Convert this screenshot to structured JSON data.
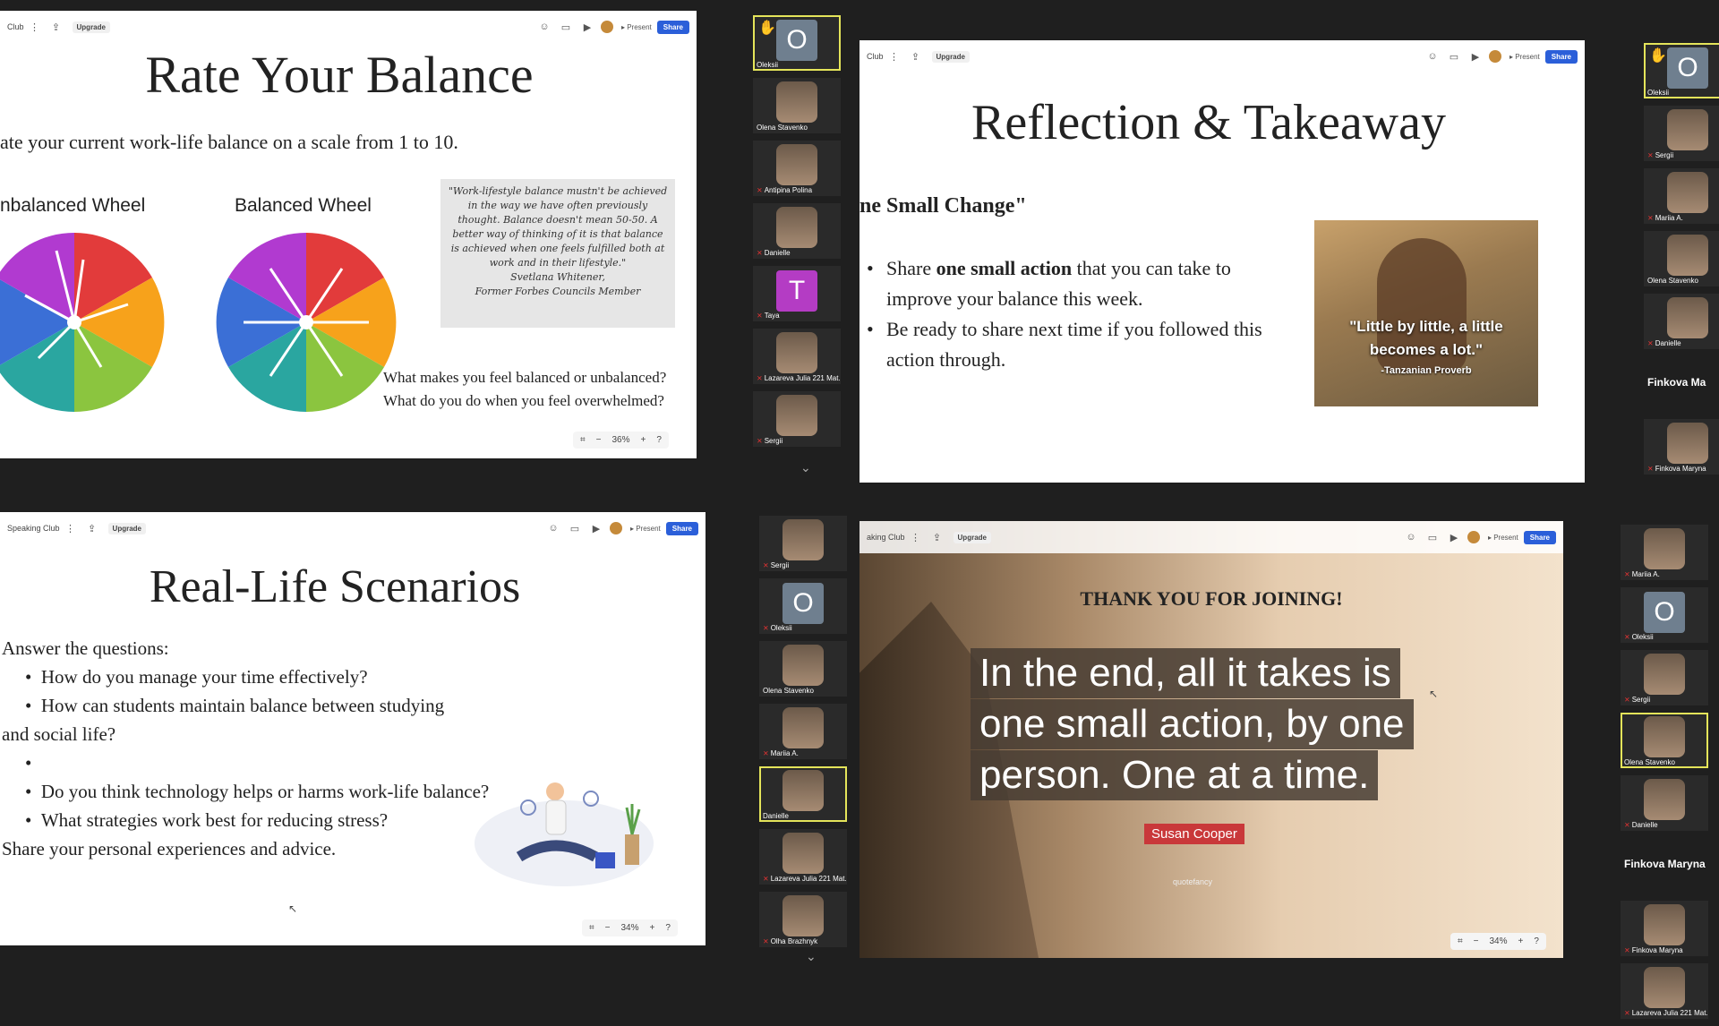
{
  "toolbar": {
    "club_short": "Club",
    "club_mid": "aking Club",
    "club_long": "Speaking Club",
    "upgrade": "Upgrade",
    "present": "Present",
    "share": "Share"
  },
  "zoom": {
    "q1": "36%",
    "q3": "34%",
    "q4": "34%"
  },
  "slide1": {
    "title": "Rate Your Balance",
    "subtitle": "ate your current work-life balance on a scale from 1 to 10.",
    "wheel1": "nbalanced Wheel",
    "wheel2": "Balanced Wheel",
    "quote": "\"Work-lifestyle balance mustn't be achieved in the way we have often previously thought. Balance doesn't mean 50-50. A better way of thinking of it is that balance is achieved when one feels fulfilled both at work and in their lifestyle.\"",
    "quote_author": "Svetlana Whitener,",
    "quote_role": "Former Forbes Councils Member",
    "q1": "What makes you feel balanced or unbalanced?",
    "q2": "What do you do when you feel overwhelmed?"
  },
  "slide2": {
    "title": "Reflection & Takeaway",
    "heading": "ne Small Change\"",
    "b1_pre": "Share ",
    "b1_bold": "one small action",
    "b1_post": " that you can take to improve your balance this week.",
    "b2": "Be ready to share next time if you followed this action through.",
    "img_quote": "\"Little by little, a little becomes a lot.\"",
    "img_src": "-Tanzanian Proverb"
  },
  "slide3": {
    "title": "Real-Life Scenarios",
    "intro": "Answer the questions:",
    "b1": "How do you manage your time effectively?",
    "b2": "How can students maintain balance between studying",
    "b2b": "and social life?",
    "b3": "Do you think technology helps or harms work-life balance?",
    "b4": "What strategies work best for reducing stress?",
    "outro": "Share your personal experiences and advice."
  },
  "slide4": {
    "heading": "THANK YOU FOR JOINING!",
    "quote1": "In the end, all it takes is",
    "quote2": "one small action, by one",
    "quote3": "person. One at a time.",
    "author": "Susan Cooper",
    "watermark": "quotefancy"
  },
  "rail1": [
    {
      "name": "Oleksii",
      "letter": "O",
      "color": "#6f7f8f",
      "hl": true,
      "hand": true
    },
    {
      "name": "Olena Stavenko"
    },
    {
      "name": "Antipina Polina",
      "mic": true
    },
    {
      "name": "Danielle",
      "mic": true
    },
    {
      "name": "Taya",
      "letter": "T",
      "color": "#b43cc4",
      "mic": true
    },
    {
      "name": "Lazareva Julia 221 Mat...",
      "mic": true
    },
    {
      "name": "Sergii",
      "mic": true
    }
  ],
  "rail2": [
    {
      "name": "Oleksii",
      "letter": "O",
      "color": "#6f7f8f",
      "hl": true,
      "hand": true
    },
    {
      "name": "Sergii",
      "mic": true
    },
    {
      "name": "Mariia A.",
      "mic": true
    },
    {
      "name": "Olena Stavenko"
    },
    {
      "name": "Danielle",
      "mic": true
    },
    {
      "name": "Finkova Ma",
      "bigname": true
    },
    {
      "name": "Finkova Maryna",
      "mic": true
    }
  ],
  "rail3": [
    {
      "name": "Sergii",
      "mic": true
    },
    {
      "name": "Oleksii",
      "letter": "O",
      "color": "#6f7f8f",
      "mic": true
    },
    {
      "name": "Olena Stavenko"
    },
    {
      "name": "Mariia A.",
      "mic": true
    },
    {
      "name": "Danielle",
      "hl": true
    },
    {
      "name": "Lazareva Julia 221 Mat...",
      "mic": true
    },
    {
      "name": "Olha Brazhnyk",
      "mic": true
    }
  ],
  "rail4": [
    {
      "name": "Mariia A.",
      "mic": true
    },
    {
      "name": "Oleksii",
      "letter": "O",
      "color": "#6f7f8f",
      "mic": true
    },
    {
      "name": "Sergii",
      "mic": true
    },
    {
      "name": "Olena Stavenko",
      "hl": true
    },
    {
      "name": "Danielle",
      "mic": true
    },
    {
      "name": "Finkova Maryna",
      "bigname": true
    },
    {
      "name": "Finkova Maryna",
      "mic": true
    },
    {
      "name": "Lazareva Julia 221 Mat...",
      "mic": true
    }
  ]
}
